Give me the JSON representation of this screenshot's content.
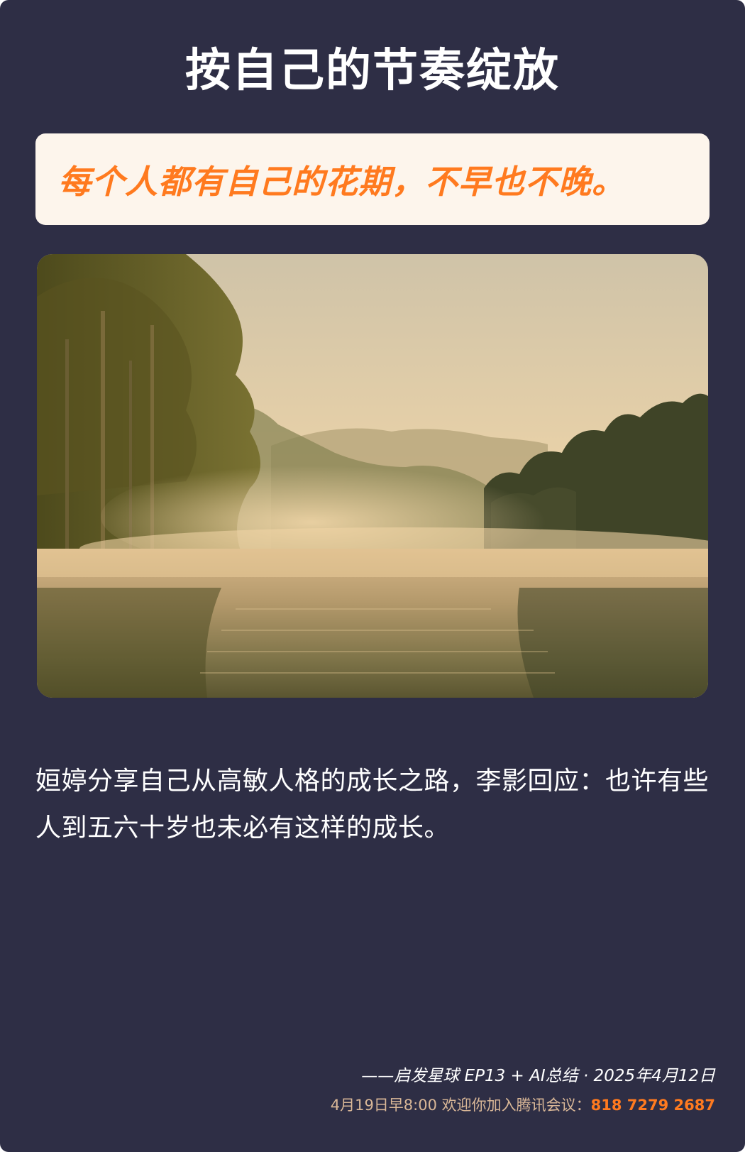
{
  "page": {
    "title": "按自己的节奏绽放",
    "quote": "每个人都有自己的花期，不早也不晚。",
    "description": "姮婷分享自己从高敏人格的成长之路，李影回应：也许有些人到五六十岁也未必有这样的成长。",
    "source": "——启发星球 EP13 + AI总结 · 2025年4月12日",
    "meeting": {
      "text": "4月19日早8:00 欢迎你加入腾讯会议：",
      "number": "818 7279 2687"
    }
  },
  "image": {
    "subject": "misty lake at sunrise with forested hills"
  },
  "colors": {
    "background": "#2e2e45",
    "quote_box": "#fdf5ec",
    "accent": "#ff7a1f",
    "meeting_text": "#d9b797",
    "text": "#ffffff"
  }
}
